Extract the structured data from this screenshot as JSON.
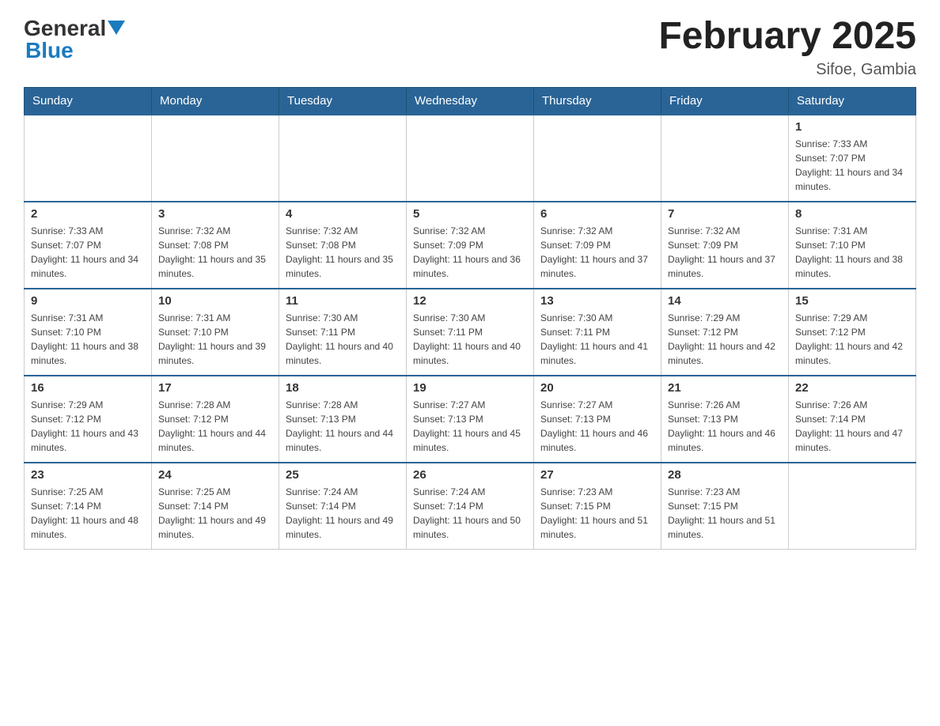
{
  "header": {
    "logo": {
      "general": "General",
      "blue": "Blue"
    },
    "title": "February 2025",
    "subtitle": "Sifoe, Gambia"
  },
  "weekdays": [
    "Sunday",
    "Monday",
    "Tuesday",
    "Wednesday",
    "Thursday",
    "Friday",
    "Saturday"
  ],
  "weeks": [
    [
      {
        "day": "",
        "info": ""
      },
      {
        "day": "",
        "info": ""
      },
      {
        "day": "",
        "info": ""
      },
      {
        "day": "",
        "info": ""
      },
      {
        "day": "",
        "info": ""
      },
      {
        "day": "",
        "info": ""
      },
      {
        "day": "1",
        "info": "Sunrise: 7:33 AM\nSunset: 7:07 PM\nDaylight: 11 hours and 34 minutes."
      }
    ],
    [
      {
        "day": "2",
        "info": "Sunrise: 7:33 AM\nSunset: 7:07 PM\nDaylight: 11 hours and 34 minutes."
      },
      {
        "day": "3",
        "info": "Sunrise: 7:32 AM\nSunset: 7:08 PM\nDaylight: 11 hours and 35 minutes."
      },
      {
        "day": "4",
        "info": "Sunrise: 7:32 AM\nSunset: 7:08 PM\nDaylight: 11 hours and 35 minutes."
      },
      {
        "day": "5",
        "info": "Sunrise: 7:32 AM\nSunset: 7:09 PM\nDaylight: 11 hours and 36 minutes."
      },
      {
        "day": "6",
        "info": "Sunrise: 7:32 AM\nSunset: 7:09 PM\nDaylight: 11 hours and 37 minutes."
      },
      {
        "day": "7",
        "info": "Sunrise: 7:32 AM\nSunset: 7:09 PM\nDaylight: 11 hours and 37 minutes."
      },
      {
        "day": "8",
        "info": "Sunrise: 7:31 AM\nSunset: 7:10 PM\nDaylight: 11 hours and 38 minutes."
      }
    ],
    [
      {
        "day": "9",
        "info": "Sunrise: 7:31 AM\nSunset: 7:10 PM\nDaylight: 11 hours and 38 minutes."
      },
      {
        "day": "10",
        "info": "Sunrise: 7:31 AM\nSunset: 7:10 PM\nDaylight: 11 hours and 39 minutes."
      },
      {
        "day": "11",
        "info": "Sunrise: 7:30 AM\nSunset: 7:11 PM\nDaylight: 11 hours and 40 minutes."
      },
      {
        "day": "12",
        "info": "Sunrise: 7:30 AM\nSunset: 7:11 PM\nDaylight: 11 hours and 40 minutes."
      },
      {
        "day": "13",
        "info": "Sunrise: 7:30 AM\nSunset: 7:11 PM\nDaylight: 11 hours and 41 minutes."
      },
      {
        "day": "14",
        "info": "Sunrise: 7:29 AM\nSunset: 7:12 PM\nDaylight: 11 hours and 42 minutes."
      },
      {
        "day": "15",
        "info": "Sunrise: 7:29 AM\nSunset: 7:12 PM\nDaylight: 11 hours and 42 minutes."
      }
    ],
    [
      {
        "day": "16",
        "info": "Sunrise: 7:29 AM\nSunset: 7:12 PM\nDaylight: 11 hours and 43 minutes."
      },
      {
        "day": "17",
        "info": "Sunrise: 7:28 AM\nSunset: 7:12 PM\nDaylight: 11 hours and 44 minutes."
      },
      {
        "day": "18",
        "info": "Sunrise: 7:28 AM\nSunset: 7:13 PM\nDaylight: 11 hours and 44 minutes."
      },
      {
        "day": "19",
        "info": "Sunrise: 7:27 AM\nSunset: 7:13 PM\nDaylight: 11 hours and 45 minutes."
      },
      {
        "day": "20",
        "info": "Sunrise: 7:27 AM\nSunset: 7:13 PM\nDaylight: 11 hours and 46 minutes."
      },
      {
        "day": "21",
        "info": "Sunrise: 7:26 AM\nSunset: 7:13 PM\nDaylight: 11 hours and 46 minutes."
      },
      {
        "day": "22",
        "info": "Sunrise: 7:26 AM\nSunset: 7:14 PM\nDaylight: 11 hours and 47 minutes."
      }
    ],
    [
      {
        "day": "23",
        "info": "Sunrise: 7:25 AM\nSunset: 7:14 PM\nDaylight: 11 hours and 48 minutes."
      },
      {
        "day": "24",
        "info": "Sunrise: 7:25 AM\nSunset: 7:14 PM\nDaylight: 11 hours and 49 minutes."
      },
      {
        "day": "25",
        "info": "Sunrise: 7:24 AM\nSunset: 7:14 PM\nDaylight: 11 hours and 49 minutes."
      },
      {
        "day": "26",
        "info": "Sunrise: 7:24 AM\nSunset: 7:14 PM\nDaylight: 11 hours and 50 minutes."
      },
      {
        "day": "27",
        "info": "Sunrise: 7:23 AM\nSunset: 7:15 PM\nDaylight: 11 hours and 51 minutes."
      },
      {
        "day": "28",
        "info": "Sunrise: 7:23 AM\nSunset: 7:15 PM\nDaylight: 11 hours and 51 minutes."
      },
      {
        "day": "",
        "info": ""
      }
    ]
  ]
}
